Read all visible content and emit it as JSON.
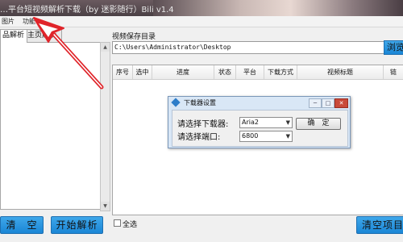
{
  "window": {
    "title": "…平台短视频解析下载（by 迷影随行）Bili v1.4"
  },
  "menu": {
    "items": [
      "图片",
      "功能"
    ]
  },
  "left_panel": {
    "tabs": [
      "品解析",
      "主页解析"
    ],
    "clear_label": "清　空",
    "parse_label": "开始解析"
  },
  "right_panel": {
    "save_dir_label": "视频保存目录",
    "save_dir_value": "C:\\Users\\Administrator\\Desktop",
    "browse_label": "浏览",
    "columns": [
      "序号",
      "选中",
      "进度",
      "状态",
      "平台",
      "下载方式",
      "视频标题",
      "链"
    ],
    "select_all_label": "全选",
    "clear_items_label": "清空项目"
  },
  "dialog": {
    "title": "下载器设置",
    "downloader_label": "请选择下载器:",
    "downloader_value": "Aria2",
    "port_label": "请选择端口:",
    "port_value": "6800",
    "ok_label": "确　定"
  },
  "colors": {
    "accent_button": "#1a86d6",
    "annotation": "#e0242a"
  }
}
